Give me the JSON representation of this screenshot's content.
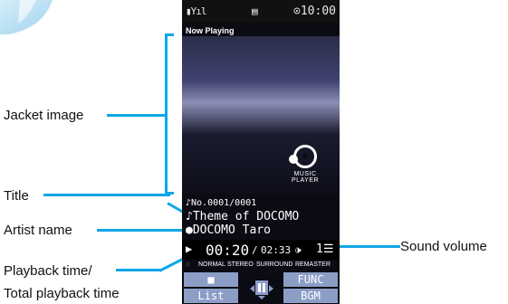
{
  "annotations": {
    "jacket": "Jacket image",
    "title": "Title",
    "artist": "Artist name",
    "playback_1": "Playback time/",
    "playback_2": "Total playback time",
    "volume": "Sound volume"
  },
  "status_bar": {
    "signal": "▮Yıl",
    "mail_icon": "▤",
    "clock": "⊙10:00"
  },
  "player": {
    "header": "Now Playing",
    "logo_text": "MUSIC PLAYER",
    "track_no": "♪No.0001/0001",
    "title": "♪Theme of DOCOMO",
    "artist": "●DOCOMO Taro",
    "play_icon": "▶",
    "elapsed": "00:20",
    "slash": "/",
    "total": "02:33",
    "volume_icon": "🕩",
    "volume_level": "1☰",
    "modes": [
      "NORMAL",
      "STEREO",
      "SURROUND",
      "REMASTER"
    ],
    "softkeys": {
      "stop": "■",
      "list": "List",
      "func": "FUNC",
      "bgm": "BGM",
      "pause": "❚❚"
    }
  },
  "colors": {
    "callout_line": "#11a6e6",
    "softkey": "#8c9dc6",
    "phone_bg": "#0b0b14"
  }
}
